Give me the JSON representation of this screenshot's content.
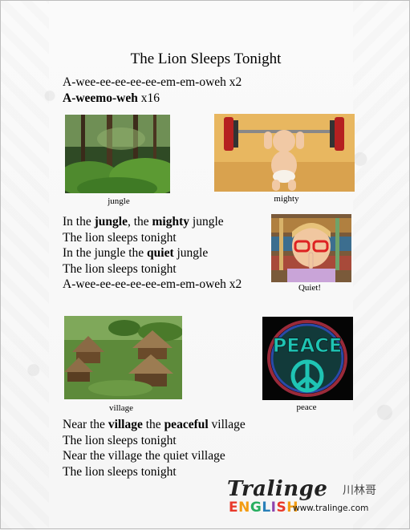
{
  "title": "The Lion Sleeps Tonight",
  "intro": {
    "line1": "A-wee-ee-ee-ee-ee-em-em-oweh x2",
    "line2_bold": "A-weemo-weh",
    "line2_rest": " x16"
  },
  "images": {
    "jungle": {
      "caption": "jungle"
    },
    "mighty": {
      "caption": "mighty"
    },
    "quiet": {
      "caption": "Quiet!"
    },
    "village": {
      "caption": "village"
    },
    "peace": {
      "caption": "peace",
      "sign_text": "PEACE"
    }
  },
  "verse1": [
    {
      "parts": [
        {
          "t": "In the ",
          "b": false
        },
        {
          "t": "jungle",
          "b": true
        },
        {
          "t": ", the ",
          "b": false
        },
        {
          "t": "mighty",
          "b": true
        },
        {
          "t": " jungle",
          "b": false
        }
      ]
    },
    {
      "parts": [
        {
          "t": "The lion sleeps tonight",
          "b": false
        }
      ]
    },
    {
      "parts": [
        {
          "t": "In the jungle the ",
          "b": false
        },
        {
          "t": "quiet",
          "b": true
        },
        {
          "t": " jungle",
          "b": false
        }
      ]
    },
    {
      "parts": [
        {
          "t": "The lion sleeps tonight",
          "b": false
        }
      ]
    },
    {
      "parts": [
        {
          "t": "A-wee-ee-ee-ee-ee-em-em-oweh x2",
          "b": false
        }
      ]
    }
  ],
  "verse2": [
    {
      "parts": [
        {
          "t": "Near the ",
          "b": false
        },
        {
          "t": "village",
          "b": true
        },
        {
          "t": " the ",
          "b": false
        },
        {
          "t": "peaceful",
          "b": true
        },
        {
          "t": " village",
          "b": false
        }
      ]
    },
    {
      "parts": [
        {
          "t": "The lion sleeps tonight",
          "b": false
        }
      ]
    },
    {
      "parts": [
        {
          "t": "Near the village the quiet village",
          "b": false
        }
      ]
    },
    {
      "parts": [
        {
          "t": "The lion sleeps tonight",
          "b": false
        }
      ]
    }
  ],
  "logo": {
    "word": "Tralinge",
    "chinese": "川林哥",
    "english_letters": [
      "E",
      "N",
      "G",
      "L",
      "I",
      "S",
      "H"
    ],
    "english_colors": [
      "#e8392b",
      "#f39c12",
      "#27ae60",
      "#2980b9",
      "#8e44ad",
      "#e8392b",
      "#f39c12"
    ],
    "url": "www.tralinge.com"
  }
}
